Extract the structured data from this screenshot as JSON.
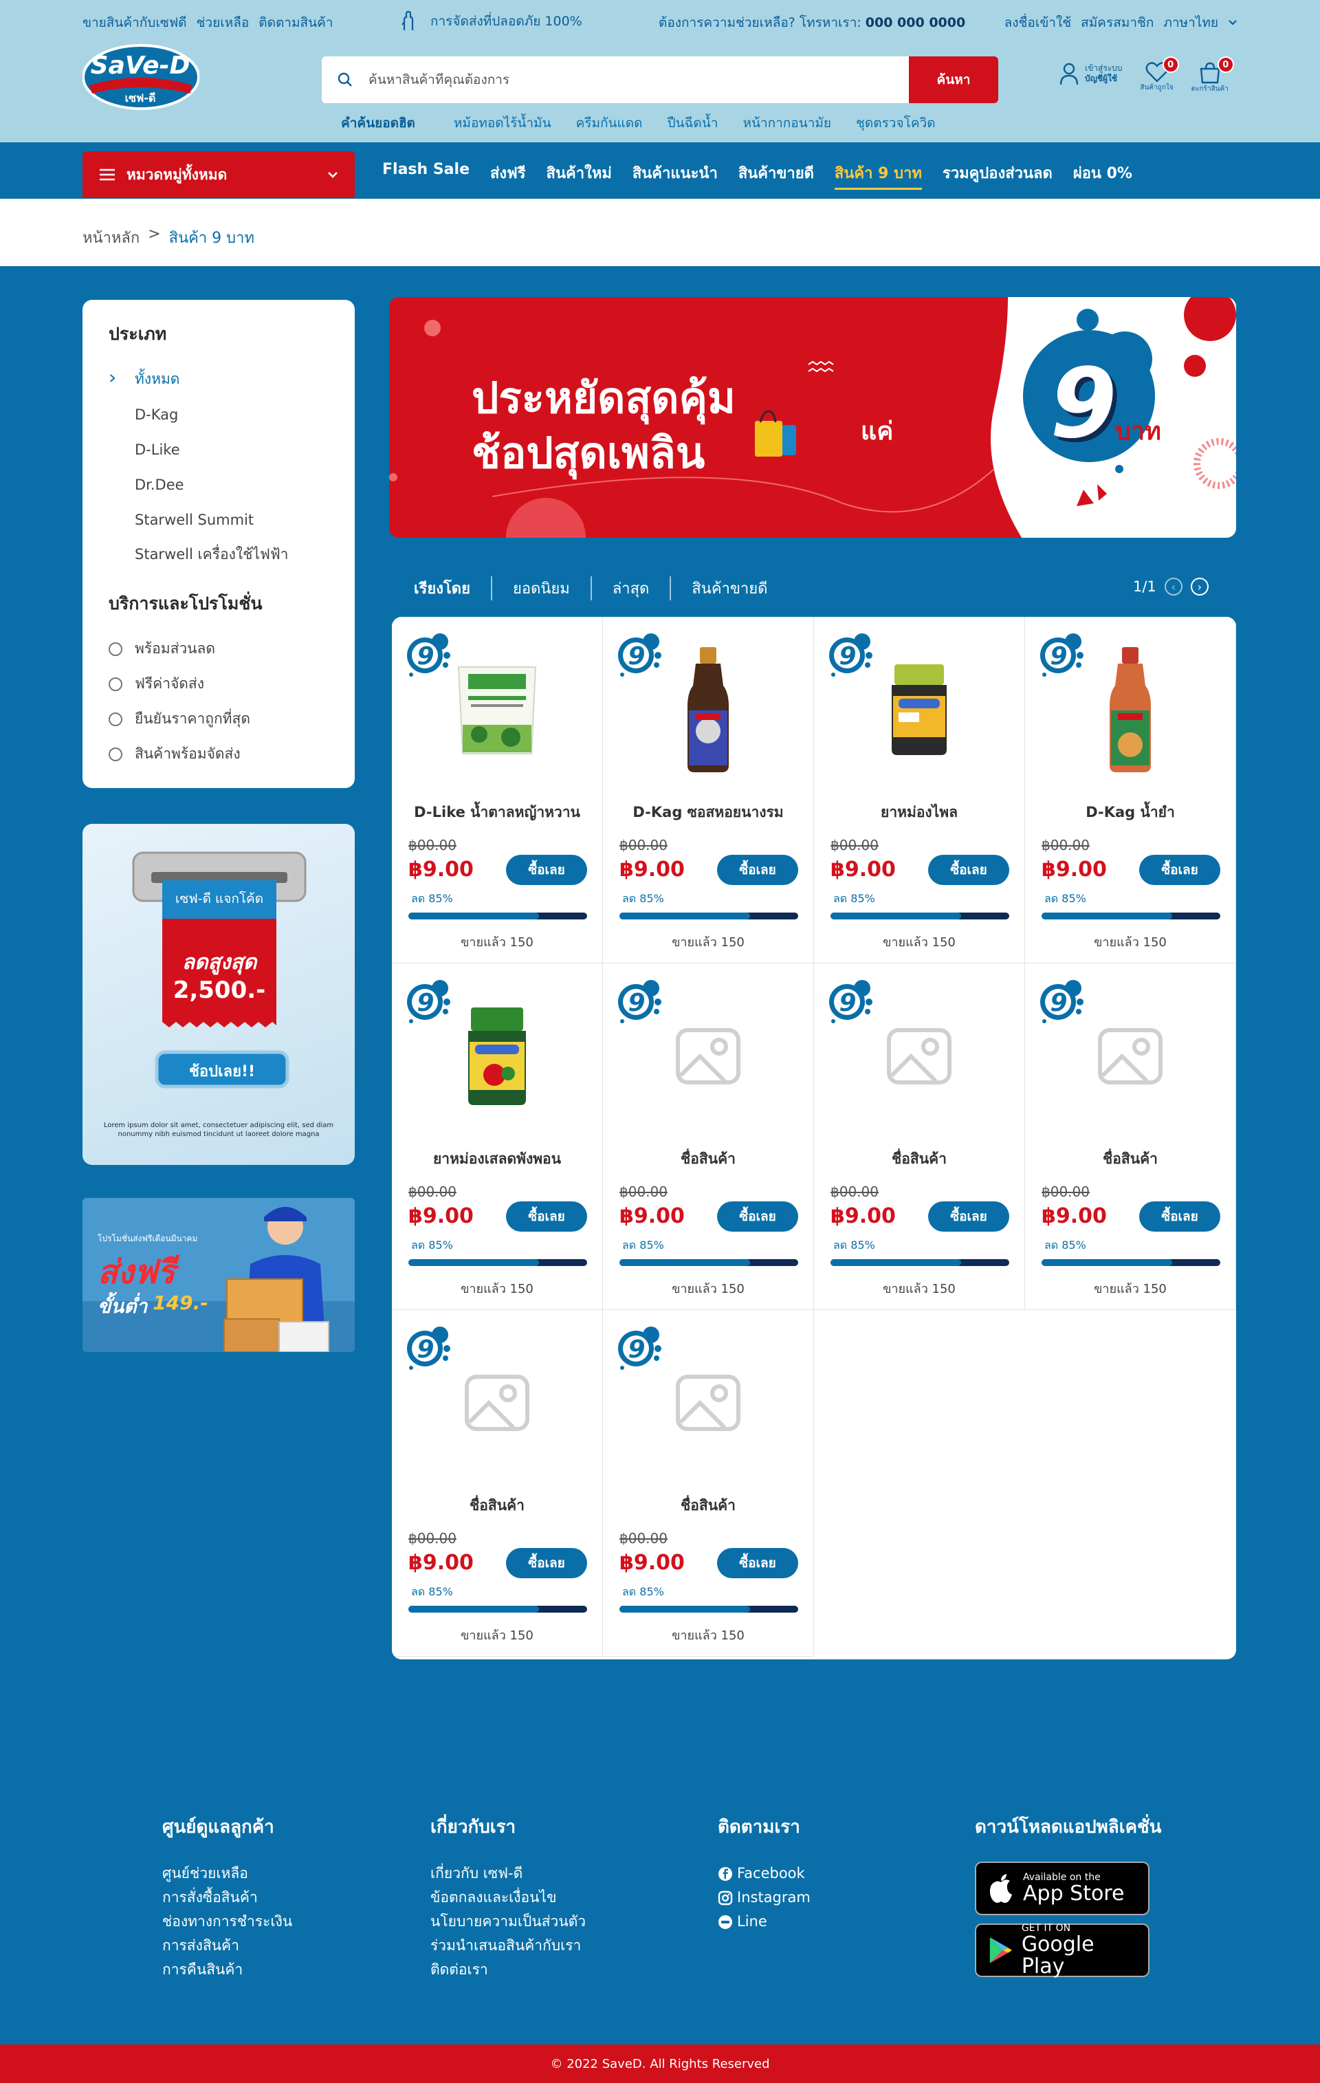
{
  "topbar": {
    "links": [
      "ขายสินค้ากับเซฟดี",
      "ช่วยเหลือ",
      "ติดตามสินค้า"
    ],
    "safe_delivery": "การจัดส่งที่ปลอดภัย 100%",
    "help_text": "ต้องการความช่วยเหลือ? โทรหาเรา:",
    "phone": "000 000 0000",
    "account_links": [
      "ลงชื่อเข้าใช้",
      "สมัครสมาชิก",
      "ภาษาไทย"
    ]
  },
  "logo": {
    "brand": "SaVe-D",
    "brand_th": "เซฟ-ดี"
  },
  "search": {
    "placeholder": "ค้นหาสินค้าที่คุณต้องการ",
    "button": "ค้นหา"
  },
  "hot_search": {
    "label": "คำค้นยอดฮิต",
    "items": [
      "หม้อทอดไร้น้ำมัน",
      "ครีมกันแดด",
      "ปืนฉีดน้ำ",
      "หน้ากากอนามัย",
      "ชุดตรวจโควิด"
    ]
  },
  "header_icons": {
    "account_line1": "เข้าสู่ระบบ",
    "account_line2": "บัญชีผู้ใช้",
    "wishlist_label": "สินค้าถูกใจ",
    "wishlist_count": "0",
    "cart_label": "ตะกร้าสินค้า",
    "cart_count": "0"
  },
  "nav": {
    "category_button": "หมวดหมู่ทั้งหมด",
    "items": [
      "Flash Sale",
      "ส่งฟรี",
      "สินค้าใหม่",
      "สินค้าแนะนำ",
      "สินค้าขายดี",
      "สินค้า 9 บาท",
      "รวมคูปองส่วนลด",
      "ผ่อน 0%"
    ],
    "active_index": 5
  },
  "breadcrumb": {
    "home": "หน้าหลัก",
    "sep": ">",
    "current": "สินค้า 9 บาท"
  },
  "sidebar": {
    "type_title": "ประเภท",
    "types": [
      "ทั้งหมด",
      "D-Kag",
      "D-Like",
      "Dr.Dee",
      "Starwell Summit",
      "Starwell เครื่องใช้ไฟฟ้า"
    ],
    "promo_title": "บริการและโปรโมชั่น",
    "promos": [
      "พร้อมส่วนลด",
      "ฟรีค่าจัดส่ง",
      "ยืนยันราคาถูกที่สุด",
      "สินค้าพร้อมจัดส่ง"
    ]
  },
  "ad_coupon": {
    "tag": "เซฟ-ดี แจกโค้ด",
    "line1": "ลดสูงสุด",
    "line2": "2,500.-",
    "button": "ช้อปเลย!!",
    "fine_print": "Lorem ipsum dolor sit amet, consectetuer adipiscing elit, sed diam nonummy nibh euismod tincidunt ut laoreet dolore magna"
  },
  "ad_shipping": {
    "small": "โปรโมชั่นส่งฟรีเดือนมีนาคม",
    "big": "ส่งฟรี",
    "min": "ขั้นต่ำ",
    "amount": "149.-"
  },
  "banner": {
    "line1": "ประหยัดสุดคุ้ม",
    "line2": "ช้อปสุดเพลิน",
    "prefix": "แค่",
    "number": "9",
    "unit": "บาท"
  },
  "sort": {
    "label": "เรียงโดย",
    "options": [
      "ยอดนิยม",
      "ล่าสุด",
      "สินค้าขายดี"
    ],
    "page": "1/1"
  },
  "products": [
    {
      "name": "D-Like น้ำตาลหญ้าหวาน",
      "old_price": "฿00.00",
      "price": "฿9.00",
      "buy": "ซื้อเลย",
      "discount": "ลด 85%",
      "progress": 0.73,
      "sold": "ขายแล้ว 150",
      "img": "d-like-stevia"
    },
    {
      "name": "D-Kag ซอสหอยนางรม",
      "old_price": "฿00.00",
      "price": "฿9.00",
      "buy": "ซื้อเลย",
      "discount": "ลด 85%",
      "progress": 0.73,
      "sold": "ขายแล้ว 150",
      "img": "oyster-sauce"
    },
    {
      "name": "ยาหม่องไพล",
      "old_price": "฿00.00",
      "price": "฿9.00",
      "buy": "ซื้อเลย",
      "discount": "ลด 85%",
      "progress": 0.73,
      "sold": "ขายแล้ว 150",
      "img": "balm-jar-yellow"
    },
    {
      "name": "D-Kag น้ำยำ",
      "old_price": "฿00.00",
      "price": "฿9.00",
      "buy": "ซื้อเลย",
      "discount": "ลด 85%",
      "progress": 0.73,
      "sold": "ขายแล้ว 150",
      "img": "spicy-sauce"
    },
    {
      "name": "ยาหม่องเสลดพังพอน",
      "old_price": "฿00.00",
      "price": "฿9.00",
      "buy": "ซื้อเลย",
      "discount": "ลด 85%",
      "progress": 0.73,
      "sold": "ขายแล้ว 150",
      "img": "balm-jar-green"
    },
    {
      "name": "ชื่อสินค้า",
      "old_price": "฿00.00",
      "price": "฿9.00",
      "buy": "ซื้อเลย",
      "discount": "ลด 85%",
      "progress": 0.73,
      "sold": "ขายแล้ว 150",
      "img": "placeholder"
    },
    {
      "name": "ชื่อสินค้า",
      "old_price": "฿00.00",
      "price": "฿9.00",
      "buy": "ซื้อเลย",
      "discount": "ลด 85%",
      "progress": 0.73,
      "sold": "ขายแล้ว 150",
      "img": "placeholder"
    },
    {
      "name": "ชื่อสินค้า",
      "old_price": "฿00.00",
      "price": "฿9.00",
      "buy": "ซื้อเลย",
      "discount": "ลด 85%",
      "progress": 0.73,
      "sold": "ขายแล้ว 150",
      "img": "placeholder"
    },
    {
      "name": "ชื่อสินค้า",
      "old_price": "฿00.00",
      "price": "฿9.00",
      "buy": "ซื้อเลย",
      "discount": "ลด 85%",
      "progress": 0.73,
      "sold": "ขายแล้ว 150",
      "img": "placeholder"
    },
    {
      "name": "ชื่อสินค้า",
      "old_price": "฿00.00",
      "price": "฿9.00",
      "buy": "ซื้อเลย",
      "discount": "ลด 85%",
      "progress": 0.73,
      "sold": "ขายแล้ว 150",
      "img": "placeholder"
    }
  ],
  "footer": {
    "customer": {
      "title": "ศูนย์ดูแลลูกค้า",
      "links": [
        "ศูนย์ช่วยเหลือ",
        "การสั่งซื้อสินค้า",
        "ช่องทางการชำระเงิน",
        "การส่งสินค้า",
        "การคืนสินค้า"
      ]
    },
    "about": {
      "title": "เกี่ยวกับเรา",
      "links": [
        "เกี่ยวกับ เซฟ-ดี",
        "ข้อตกลงและเงื่อนไข",
        "นโยบายความเป็นส่วนตัว",
        "ร่วมนำเสนอสินค้ากับเรา",
        "ติดต่อเรา"
      ]
    },
    "follow": {
      "title": "ติดตามเรา",
      "links": [
        "Facebook",
        "Instagram",
        "Line"
      ]
    },
    "apps": {
      "title": "ดาวน์โหลดแอปพลิเคชั่น",
      "appstore_small": "Available on the",
      "appstore_big": "App Store",
      "play_small": "GET IT ON",
      "play_big": "Google Play"
    },
    "copyright": "© 2022 SaveD. All Rights Reserved"
  },
  "colors": {
    "primary": "#0a6fa8",
    "accent": "#d0101a",
    "highlight": "#ffc83a",
    "topbar": "#a9d4e4"
  }
}
